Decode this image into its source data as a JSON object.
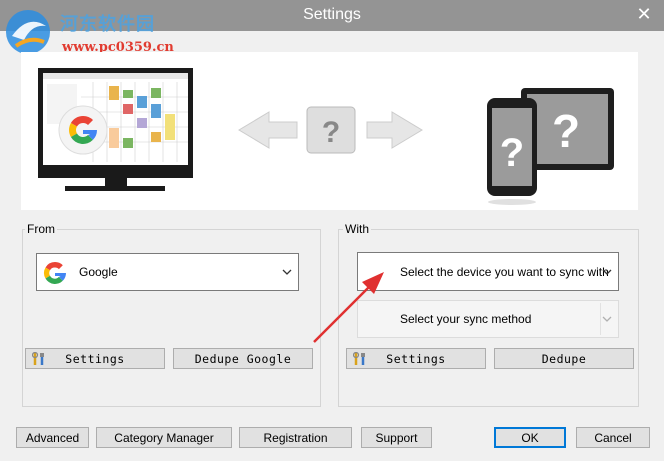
{
  "window": {
    "title": "Settings",
    "close_glyph": "✕",
    "titlebar_color": "#949494"
  },
  "watermark": {
    "site_name_cn": "河东软件园",
    "url": "www.pc0359.cn"
  },
  "banner": {
    "left_device": "monitor-with-google-calendar",
    "middle": "question-mark",
    "right_device": "unknown-phone-and-tablet"
  },
  "from_group": {
    "label": "From",
    "source": {
      "selected": "Google",
      "icon": "google-icon"
    },
    "settings_button": "Settings",
    "dedupe_button": "Dedupe Google"
  },
  "with_group": {
    "label": "With",
    "device_select": {
      "selected": "Select the device you want to sync with"
    },
    "method_select": {
      "selected": "Select your sync method",
      "disabled": true
    },
    "settings_button": "Settings",
    "dedupe_button": "Dedupe"
  },
  "footer": {
    "advanced": "Advanced",
    "category_manager": "Category Manager",
    "registration": "Registration",
    "support": "Support",
    "ok": "OK",
    "cancel": "Cancel"
  },
  "colors": {
    "accent": "#0078d7",
    "annotation_arrow": "#e03030",
    "google_blue": "#4285f4",
    "google_red": "#ea4335",
    "google_yellow": "#fbbc05",
    "google_green": "#34a853"
  }
}
